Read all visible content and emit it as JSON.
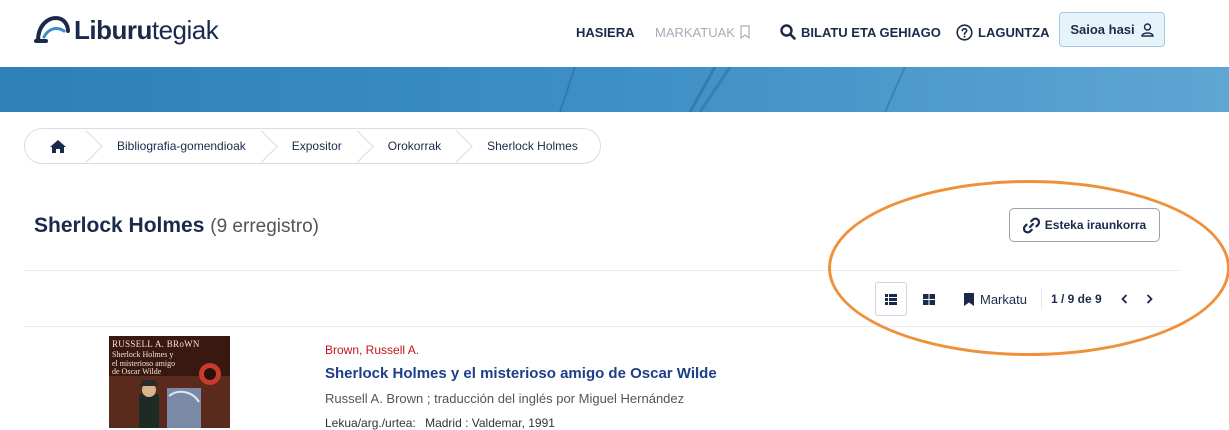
{
  "header": {
    "logo": {
      "bold": "Liburu",
      "light": "tegiak"
    },
    "nav": {
      "home": "HASIERA",
      "bookmarks": "MARKATUAK",
      "search": "BILATU ETA GEHIAGO",
      "help": "LAGUNTZA"
    },
    "login": "Saioa hasi"
  },
  "breadcrumb": {
    "items": [
      "Bibliografia-gomendioak",
      "Expositor",
      "Orokorrak",
      "Sherlock Holmes"
    ]
  },
  "page": {
    "title": "Sherlock Holmes",
    "count": "(9 erregistro)",
    "permalink": "Esteka iraunkorra"
  },
  "toolbar": {
    "mark": "Markatu",
    "pager": "1 / 9 de 9"
  },
  "record": {
    "cover": {
      "author": "RUSSELL A. BRoWN",
      "title": "Sherlock Holmes y\nel misterioso amigo\nde Oscar Wilde"
    },
    "author": "Brown, Russell A.",
    "title": "Sherlock Holmes y el misterioso amigo de Oscar Wilde",
    "responsibility": "Russell A. Brown ; traducción del inglés por Miguel Hernández",
    "publication_label": "Lekua/arg./urtea:",
    "publication": "Madrid : Valdemar, 1991"
  },
  "colors": {
    "brand_navy": "#1b2a4a",
    "banner_blue": "#3b8cc4",
    "author_red": "#c0161c",
    "title_blue": "#1d3f87",
    "highlight_orange": "#f0903a"
  }
}
